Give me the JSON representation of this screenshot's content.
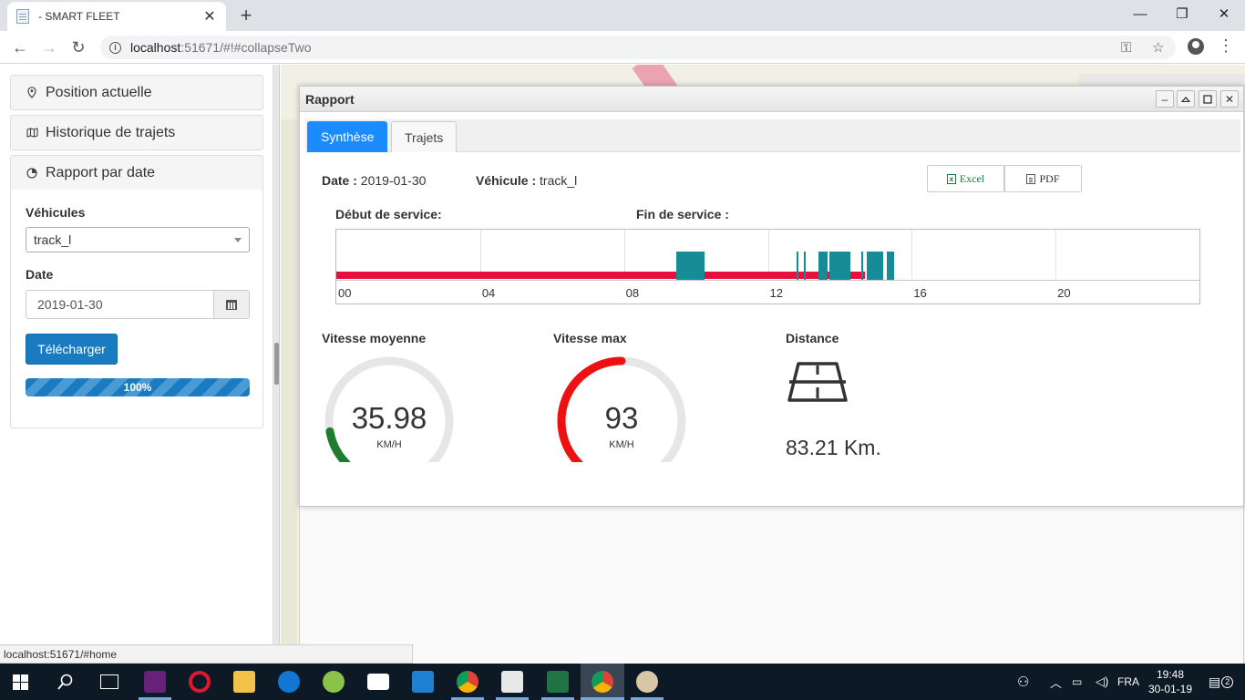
{
  "browser": {
    "tab_title": "- SMART FLEET",
    "url_host": "localhost",
    "url_rest": ":51671/#!#collapseTwo",
    "status_url": "localhost:51671/#home"
  },
  "sidebar": {
    "items": [
      {
        "label": "Position actuelle",
        "icon": "map-marker-icon"
      },
      {
        "label": "Historique de trajets",
        "icon": "map-icon"
      },
      {
        "label": "Rapport par date",
        "icon": "pie-chart-icon"
      }
    ],
    "vehicles_label": "Véhicules",
    "vehicle_value": "track_l",
    "date_label": "Date",
    "date_value": "2019-01-30",
    "download_label": "Télécharger",
    "progress_text": "100%",
    "progress_value": 1.0
  },
  "report": {
    "window_title": "Rapport",
    "tabs": [
      "Synthèse",
      "Trajets"
    ],
    "active_tab": 0,
    "date_label": "Date :",
    "date_value": "2019-01-30",
    "vehicle_label": "Véhicule :",
    "vehicle_value": "track_l",
    "excel_label": "Excel",
    "pdf_label": "PDF",
    "start_label": "Début de service:",
    "end_label": "Fin de service :",
    "timeline": {
      "ticks": [
        "00",
        "04",
        "08",
        "12",
        "16",
        "20"
      ],
      "range_hours": [
        0,
        24
      ],
      "active_until_hour": 14.7,
      "blocks_hours": [
        [
          9.45,
          10.25
        ],
        [
          12.8,
          12.85
        ],
        [
          13.0,
          13.05
        ],
        [
          13.4,
          13.65
        ],
        [
          13.7,
          14.3
        ],
        [
          14.6,
          14.65
        ],
        [
          14.75,
          15.2
        ],
        [
          15.3,
          15.5
        ]
      ],
      "colors": {
        "active": "#e8103a",
        "stop": "#168c96"
      }
    },
    "avg_speed": {
      "title": "Vitesse moyenne",
      "value": "35.98",
      "unit": "KM/H",
      "fill_fraction": 0.13,
      "color": "#1e7d2e"
    },
    "max_speed": {
      "title": "Vitesse max",
      "value": "93",
      "unit": "KM/H",
      "fill_fraction": 0.5,
      "color": "#ee1111"
    },
    "distance": {
      "title": "Distance",
      "value": "83.21 Km.",
      "icon": "road-icon"
    }
  },
  "taskbar": {
    "lang": "FRA",
    "time": "19:48",
    "date": "30-01-19",
    "notifications": "2"
  }
}
